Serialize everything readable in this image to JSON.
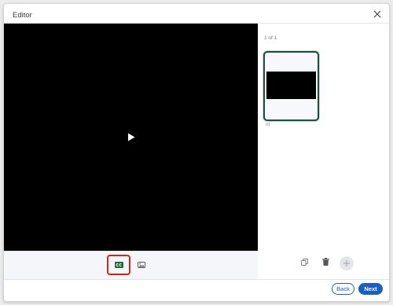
{
  "dialog": {
    "title": "Editor"
  },
  "icons": {
    "close": "close-icon",
    "play": "play-icon",
    "cc": "closed-captions-icon",
    "image": "image-icon",
    "duplicate": "duplicate-icon",
    "trash": "trash-icon",
    "add": "plus-icon"
  },
  "panel": {
    "page_count": "1 of 1",
    "thumbnails": [
      {
        "label": "01"
      }
    ]
  },
  "footer": {
    "back_label": "Back",
    "next_label": "Next"
  },
  "colors": {
    "primary": "#1a5ec6",
    "cc_icon": "#1e6b3e",
    "highlight": "#d2231c",
    "thumb_border": "#1e4f3a"
  }
}
